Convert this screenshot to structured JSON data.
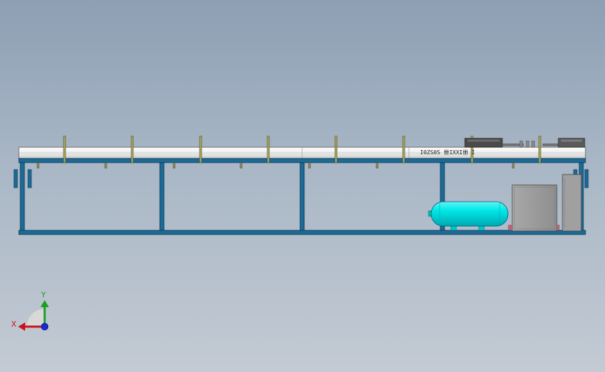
{
  "model": {
    "engraved_text": "I0ZS0S 卌IXXI卌 I"
  },
  "triad": {
    "x_label": "X",
    "y_label": "Y",
    "colors": {
      "x": "#c8141e",
      "y": "#18a020",
      "z": "#1a2ad0"
    }
  },
  "colors": {
    "frame": "#1d6a94",
    "frame_edge": "#0c3a55",
    "conveyor": "#f4f4f4",
    "tank": "#00e6e6",
    "cabinet": "#9a9a9a",
    "posts": "#9a9a50"
  }
}
